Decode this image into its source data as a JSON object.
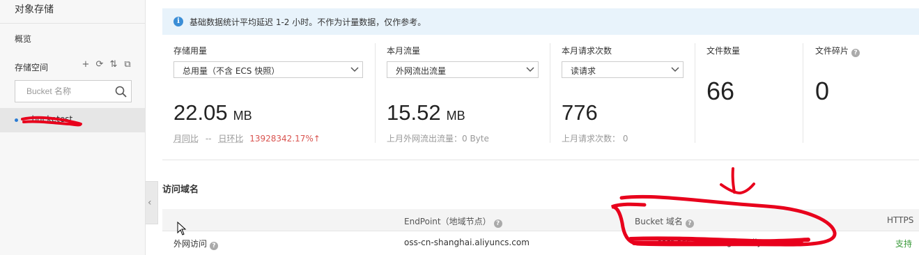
{
  "sidebar": {
    "title": "对象存储",
    "overview": "概览",
    "section": "存储空间",
    "tools": {
      "add": "+",
      "refresh": "⟳",
      "sort": "⇅",
      "expand": "⧉"
    },
    "search": {
      "placeholder": "Bucket 名称",
      "value": ""
    },
    "bucket": {
      "name": "...bucketest"
    }
  },
  "notice": {
    "text": "基础数据统计平均延迟 1-2 小时。不作为计量数据，仅作参考。"
  },
  "stats": {
    "storage": {
      "label": "存储用量",
      "select": "总用量（不含 ECS 快照）",
      "value": "22.05",
      "unit": "MB",
      "mom": "月同比",
      "mom_val": "--",
      "dod": "日环比",
      "dod_val": "13928342.17%↑"
    },
    "traffic": {
      "label": "本月流量",
      "select": "外网流出流量",
      "value": "15.52",
      "unit": "MB",
      "sub": "上月外网流出流量：0 Byte"
    },
    "requests": {
      "label": "本月请求次数",
      "select": "读请求",
      "value": "776",
      "sub": "上月请求次数： 0"
    },
    "files": {
      "label": "文件数量",
      "value": "66"
    },
    "fragments": {
      "label": "文件碎片",
      "value": "0"
    }
  },
  "access": {
    "title": "访问域名",
    "headers": {
      "endpoint": "EndPoint（地域节点）",
      "bucket_domain": "Bucket 域名",
      "https": "HTTPS"
    },
    "rows": [
      {
        "type": "外网访问",
        "endpoint": "oss-cn-shanghai.aliyuncs.com",
        "bucket_domain": "...test.oss-cn-shanghai.aliyuncs.com",
        "https": "支持"
      }
    ]
  },
  "colors": {
    "accent": "#2b7cd3",
    "notice_bg": "#e8f3fb",
    "annotation": "#e8001c",
    "ok": "#3a9a3a",
    "warn": "#d9534f"
  }
}
